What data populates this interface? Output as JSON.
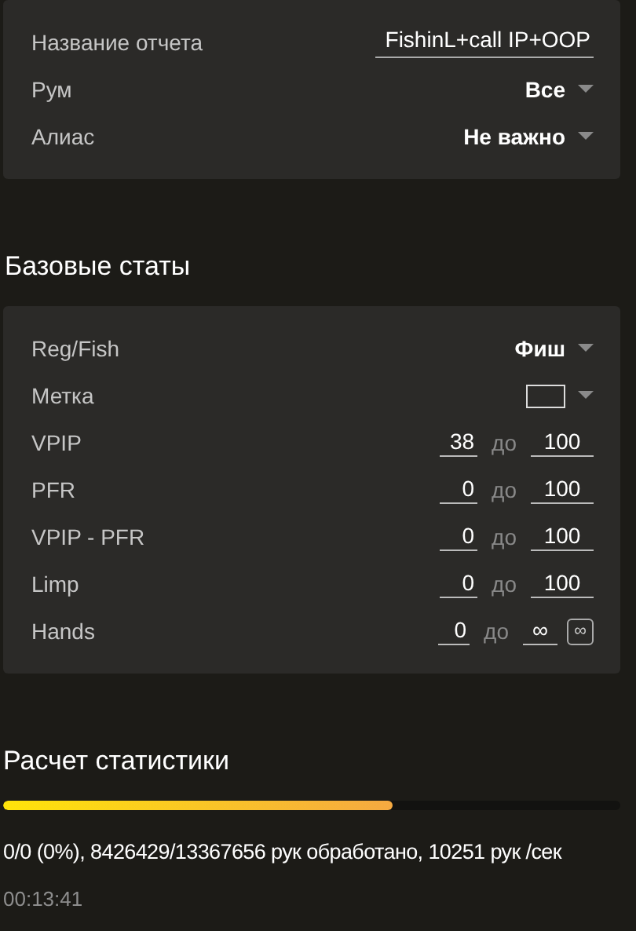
{
  "report_card": {
    "rows": [
      {
        "kind": "text",
        "label": "Название отчета",
        "value": "FishinL+call IP+OOP"
      },
      {
        "kind": "dropdown",
        "label": "Рум",
        "value": "Все"
      },
      {
        "kind": "dropdown",
        "label": "Алиас",
        "value": "Не важно"
      }
    ]
  },
  "base_stats": {
    "title": "Базовые статы",
    "rows": [
      {
        "kind": "dropdown",
        "label": "Reg/Fish",
        "value": "Фиш"
      },
      {
        "kind": "color",
        "label": "Метка"
      },
      {
        "kind": "range",
        "label": "VPIP",
        "min": "38",
        "sep": "до",
        "max": "100"
      },
      {
        "kind": "range",
        "label": "PFR",
        "min": "0",
        "sep": "до",
        "max": "100"
      },
      {
        "kind": "range",
        "label": "VPIP - PFR",
        "min": "0",
        "sep": "до",
        "max": "100"
      },
      {
        "kind": "range",
        "label": "Limp",
        "min": "0",
        "sep": "до",
        "max": "100"
      },
      {
        "kind": "range",
        "label": "Hands",
        "min": "0",
        "sep": "до",
        "max": "∞",
        "toggle": "∞"
      }
    ]
  },
  "calculation": {
    "title": "Расчет статистики",
    "level": 0.63,
    "status": "0/0 (0%), 8426429/13367656 рук обработано, 10251 рук /сек",
    "elapsed": "00:13:41"
  }
}
